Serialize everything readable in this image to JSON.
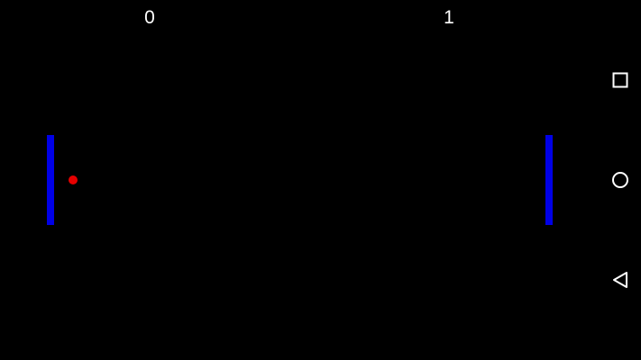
{
  "scores": {
    "left": "0",
    "right": "1"
  },
  "colors": {
    "background": "#000000",
    "paddle": "#0000e6",
    "ball": "#e60000",
    "text": "#ffffff"
  },
  "navbar": {
    "icons": [
      "recents-icon",
      "home-icon",
      "back-icon"
    ]
  }
}
